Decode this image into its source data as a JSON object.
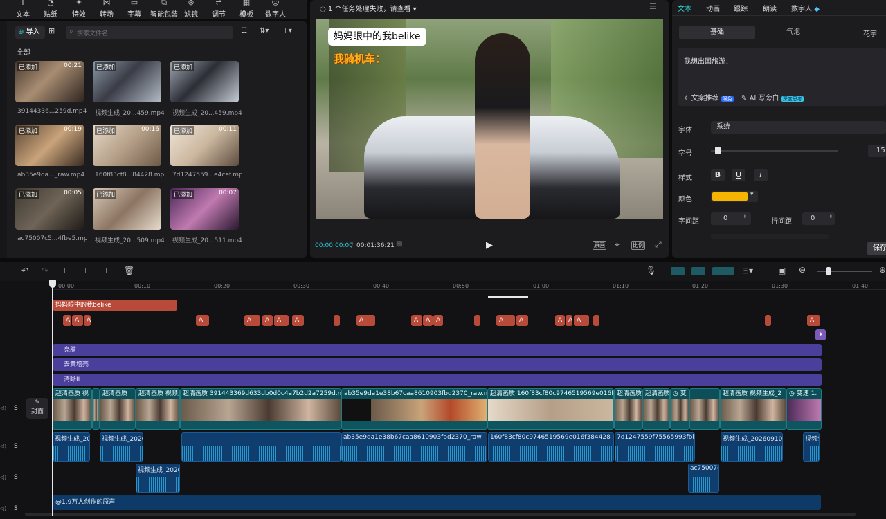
{
  "toolbar": {
    "items": [
      {
        "label": "文本",
        "icon": "text-icon"
      },
      {
        "label": "贴纸",
        "icon": "sticker-icon"
      },
      {
        "label": "特效",
        "icon": "effects-icon"
      },
      {
        "label": "转场",
        "icon": "transition-icon"
      },
      {
        "label": "字幕",
        "icon": "caption-icon"
      },
      {
        "label": "智能包装",
        "icon": "smart-package-icon"
      },
      {
        "label": "滤镜",
        "icon": "filter-icon"
      },
      {
        "label": "调节",
        "icon": "adjust-icon"
      },
      {
        "label": "模板",
        "icon": "template-icon"
      },
      {
        "label": "数字人",
        "icon": "digital-human-icon"
      }
    ]
  },
  "media": {
    "import_label": "导入",
    "search_placeholder": "搜索文件名",
    "section": "全部",
    "items": [
      {
        "badge": "已添加",
        "duration": "00:21",
        "name": "39144336...259d.mp4"
      },
      {
        "badge": "已添加",
        "duration": "",
        "name": "视频生成_20...459.mp4"
      },
      {
        "badge": "已添加",
        "duration": "",
        "name": "视频生成_20...459.mp4"
      },
      {
        "badge": "已添加",
        "duration": "00:19",
        "name": "ab35e9da..._raw.mp4"
      },
      {
        "badge": "已添加",
        "duration": "00:16",
        "name": "160f83cf8...84428.mp4"
      },
      {
        "badge": "已添加",
        "duration": "00:11",
        "name": "7d1247559...e4cef.mp4"
      },
      {
        "badge": "已添加",
        "duration": "00:05",
        "name": "ac75007c5...4fbe5.mp4"
      },
      {
        "badge": "已添加",
        "duration": "",
        "name": "视频生成_20...509.mp4"
      },
      {
        "badge": "已添加",
        "duration": "00:07",
        "name": "视频生成_20...511.mp4"
      }
    ]
  },
  "player": {
    "status": "1 个任务处理失败，请查看",
    "caption_top": "妈妈眼中的我belike",
    "caption_bottom": "我骑机车：",
    "time_current": "00:00:00:00",
    "time_total": "00:01:36:21",
    "btn_original": "原画",
    "btn_ratio": "比例"
  },
  "inspector": {
    "tabs": [
      "文本",
      "动画",
      "跟踪",
      "朗读",
      "数字人"
    ],
    "subtabs": [
      "基础",
      "气泡",
      "花字"
    ],
    "text_value": "我想出国旅游：",
    "recommend": "文案推荐",
    "recommend_badge": "限免",
    "ai_write": "AI 写旁白",
    "ai_badge": "深度思考",
    "font_label": "字体",
    "font_value": "系统",
    "size_label": "字号",
    "size_value": "15",
    "style_label": "样式",
    "color_label": "颜色",
    "color_value": "#f4b400",
    "spacing_label": "字间距",
    "spacing_value": "0",
    "line_label": "行间距",
    "line_value": "0",
    "save": "保存"
  },
  "timeline": {
    "ticks": [
      "00:00",
      "00:10",
      "00:20",
      "00:30",
      "00:40",
      "00:50",
      "01:00",
      "01:10",
      "01:20",
      "01:30",
      "01:40"
    ],
    "title_clip": "妈妈眼中的我belike",
    "cover_label": "封面",
    "effects": [
      "亮肤",
      "去黄增亮",
      "清晰II"
    ],
    "video_clips": [
      "超清画质 视",
      "超清画质",
      "超清画质 视频生",
      "超清画质 391443369d633db0d0c4a7b2d2a7259d.mp4 00",
      "ab35e9da1e38b67caa8610903fbd2370_raw.mp4 00",
      "超清画质 160f83cf80c9746519569e016f3844",
      "超清画质",
      "超清画质",
      "变",
      "超清画质 视频生成_2",
      "变速 1."
    ],
    "audio_clips": [
      "视频生成_202",
      "视频生成_20260",
      "ab35e9da1e38b67caa8610903fbd2370_raw",
      "160f83cf80c9746519569e016f384428",
      "7d1247559f75565993fbbf1",
      "视频生成_20260910_1",
      "视频生"
    ],
    "audio2_clips": [
      "视频生成_20260",
      "ac75007c5"
    ],
    "original_sound": "@1.9万人创作的原声",
    "track_s": "S"
  }
}
